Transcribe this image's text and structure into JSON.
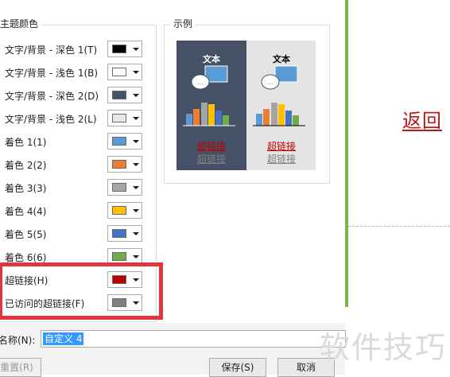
{
  "dialog": {
    "theme_colors_title": "主题颜色",
    "theme_colors": [
      {
        "label": "文字/背景 - 深色 1(T)",
        "color": "#000000"
      },
      {
        "label": "文字/背景 - 浅色 1(B)",
        "color": "#ffffff"
      },
      {
        "label": "文字/背景 - 深色 2(D)",
        "color": "#44546a"
      },
      {
        "label": "文字/背景 - 浅色 2(L)",
        "color": "#e7e6e6"
      },
      {
        "label": "着色 1(1)",
        "color": "#5b9bd5"
      },
      {
        "label": "着色 2(2)",
        "color": "#ed7d31"
      },
      {
        "label": "着色 3(3)",
        "color": "#a5a5a5"
      },
      {
        "label": "着色 4(4)",
        "color": "#ffc000"
      },
      {
        "label": "着色 5(5)",
        "color": "#4472c4"
      },
      {
        "label": "着色 6(6)",
        "color": "#70ad47"
      },
      {
        "label": "超链接(H)",
        "color": "#c00000"
      },
      {
        "label": "已访问的超链接(F)",
        "color": "#808080"
      }
    ],
    "sample_title": "示例",
    "sample": {
      "text_label": "文本",
      "hyperlink": "超链接",
      "visited_hyperlink": "超链接"
    },
    "name_label": "名称(N):",
    "name_value": "自定义 4",
    "reset_label": "重置(R)",
    "save_label": "保存(S)",
    "cancel_label": "取消"
  },
  "slide": {
    "return_link": "返回"
  },
  "watermark": "软件技巧"
}
